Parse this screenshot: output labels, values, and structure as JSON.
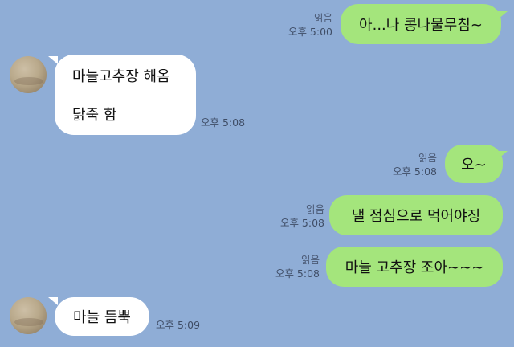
{
  "messages": [
    {
      "side": "sent",
      "text": "아...나 콩나물무침~",
      "read": "읽음",
      "time": "오후 5:00"
    },
    {
      "side": "recv",
      "lines": [
        "마늘고추장 해옴",
        "닭죽 함"
      ],
      "time": "오후 5:08"
    },
    {
      "side": "sent",
      "text": "오~",
      "read": "읽음",
      "time": "오후 5:08"
    },
    {
      "side": "sent",
      "text": "낼 점심으로 먹어야징",
      "read": "읽음",
      "time": "오후 5:08"
    },
    {
      "side": "sent",
      "text": "마늘 고추장 조아~~~",
      "read": "읽음",
      "time": "오후 5:08"
    },
    {
      "side": "recv",
      "lines": [
        "마늘 듬뿍"
      ],
      "time": "오후 5:09"
    }
  ],
  "colors": {
    "background": "#8fadd6",
    "sent_bubble": "#a4e57c",
    "recv_bubble": "#ffffff"
  }
}
